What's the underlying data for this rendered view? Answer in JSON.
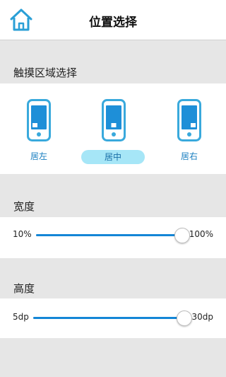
{
  "header": {
    "title": "位置选择",
    "home_icon": "home-icon"
  },
  "touch_area": {
    "label": "触摸区域选择",
    "options": [
      {
        "label": "居左",
        "icon": "phone-icon",
        "selected": false
      },
      {
        "label": "居中",
        "icon": "phone-icon",
        "selected": true
      },
      {
        "label": "居右",
        "icon": "phone-icon",
        "selected": false
      }
    ]
  },
  "width": {
    "label": "宽度",
    "min_label": "10%",
    "max_label": "100%",
    "value_fraction": 1.0
  },
  "height": {
    "label": "高度",
    "min_label": "5dp",
    "max_label": "30dp",
    "value_fraction": 1.0
  },
  "colors": {
    "accent": "#1486d6",
    "selected_pill": "#a6e6f7",
    "label_blue": "#1a7fc0"
  }
}
